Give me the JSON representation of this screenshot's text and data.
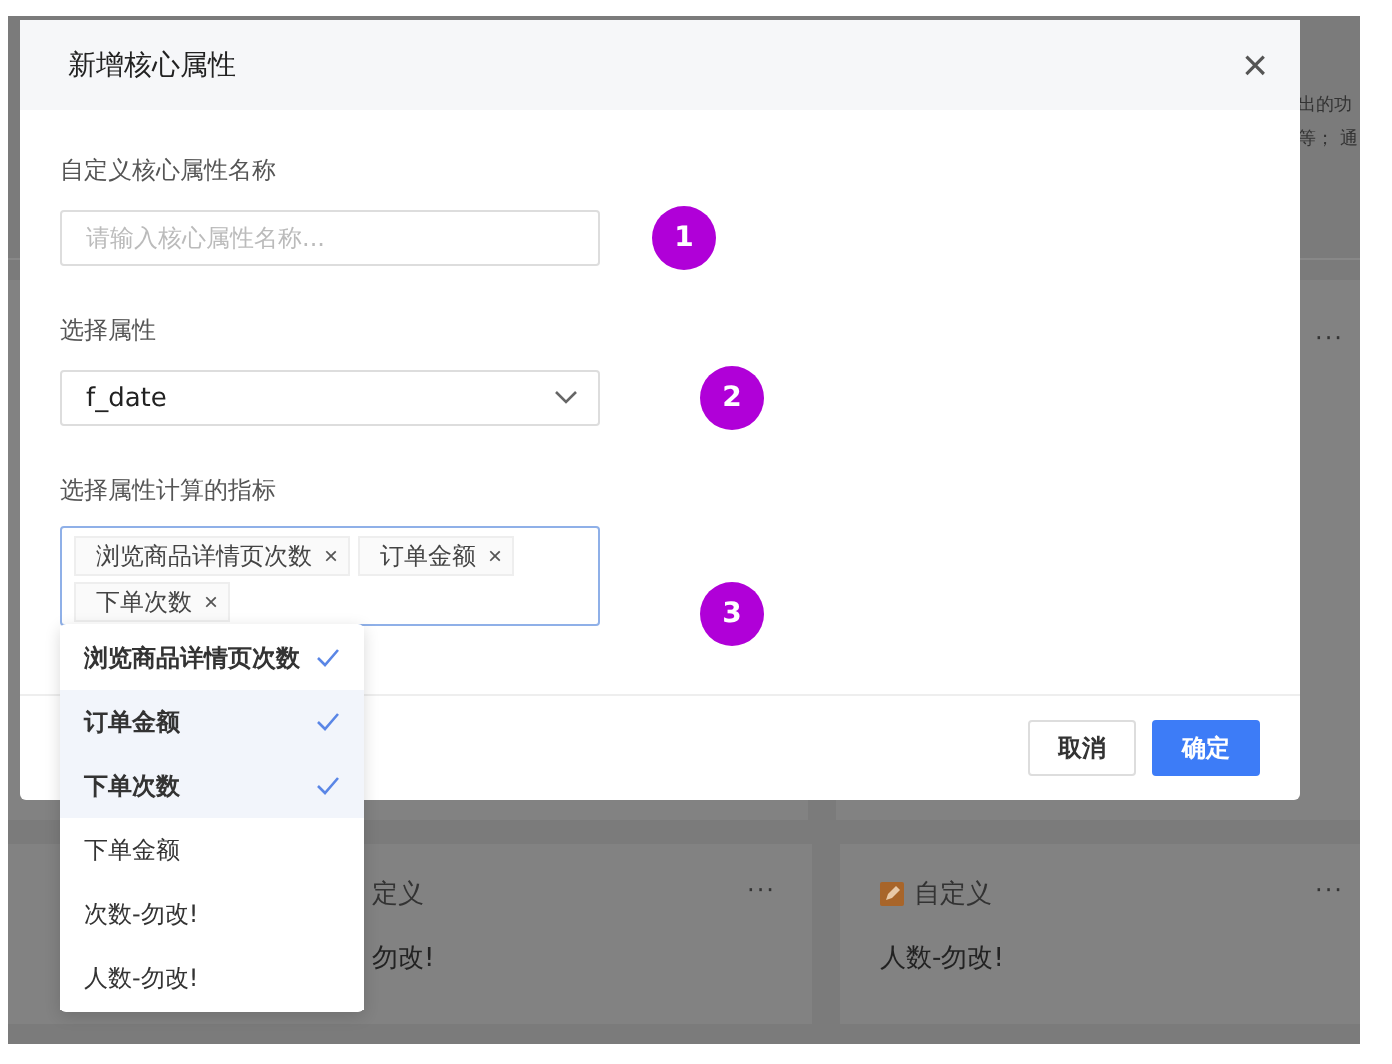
{
  "background": {
    "header_lines": [
      "出的功",
      "等； 通"
    ],
    "cards": [
      {
        "kind": "partial",
        "tag": "定义",
        "text": "勿改!",
        "more": "···"
      },
      {
        "kind": "custom",
        "tag": "自定义",
        "text": "人数-勿改!",
        "more": "···"
      }
    ],
    "upper_card": {
      "more": "···"
    }
  },
  "dialog": {
    "title": "新增核心属性",
    "close": "×",
    "fields": [
      {
        "kind": "text",
        "label": "自定义核心属性名称",
        "placeholder": "请输入核心属性名称...",
        "badge": "1"
      },
      {
        "kind": "select",
        "label": "选择属性",
        "value": "f_date",
        "badge": "2"
      },
      {
        "kind": "multi",
        "label": "选择属性计算的指标",
        "tags": [
          {
            "label": "浏览商品详情页次数",
            "remove": "×"
          },
          {
            "label": "订单金额",
            "remove": "×"
          },
          {
            "label": "下单次数",
            "remove": "×"
          }
        ],
        "badge": "3"
      }
    ],
    "buttons": [
      {
        "label": "取消",
        "primary": false
      },
      {
        "label": "确定",
        "primary": true
      }
    ]
  },
  "dropdown": [
    {
      "label": "浏览商品详情页次数",
      "selected": true,
      "highlighted": false
    },
    {
      "label": "订单金额",
      "selected": true,
      "highlighted": true
    },
    {
      "label": "下单次数",
      "selected": true,
      "highlighted": true
    },
    {
      "label": "下单金额",
      "selected": false,
      "highlighted": false
    },
    {
      "label": "次数-勿改!",
      "selected": false,
      "highlighted": false
    },
    {
      "label": "人数-勿改!",
      "selected": false,
      "highlighted": false
    }
  ]
}
